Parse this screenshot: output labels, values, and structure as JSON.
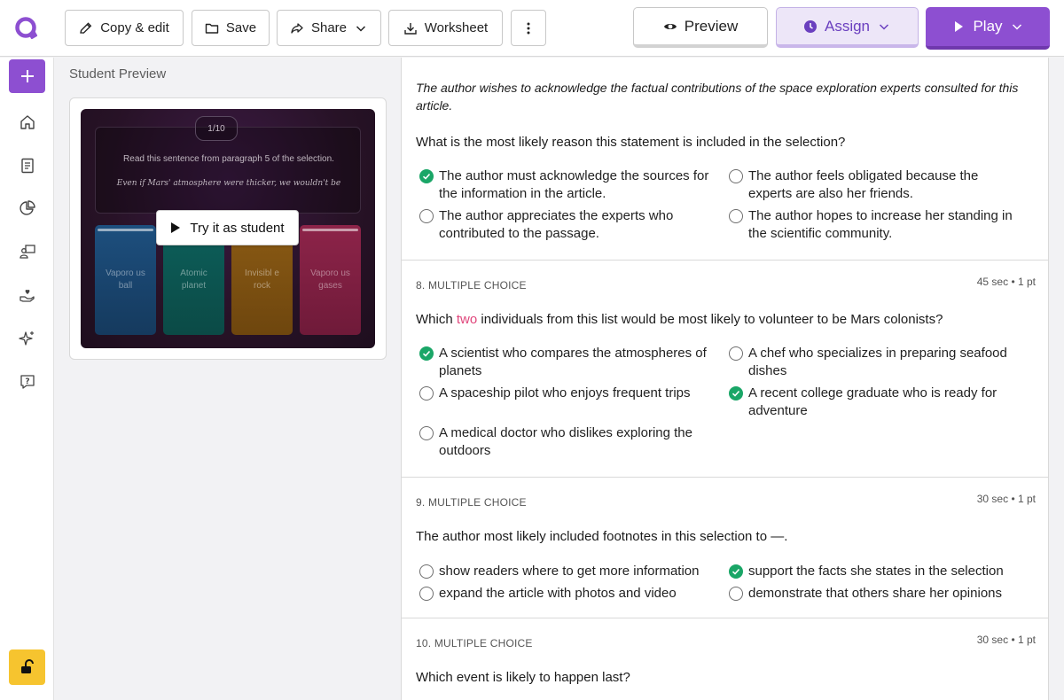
{
  "toolbar": {
    "copy_edit": "Copy & edit",
    "save": "Save",
    "share": "Share",
    "worksheet": "Worksheet",
    "preview": "Preview",
    "assign": "Assign",
    "play": "Play"
  },
  "colors": {
    "brand_purple": "#8d4fd1",
    "correct_green": "#1aa667",
    "highlight_pink": "#e0457b",
    "lock_yellow": "#f6c42f"
  },
  "sidebar": {
    "icons": [
      "add-icon",
      "home-icon",
      "library-icon",
      "reports-icon",
      "classes-icon",
      "accommodations-icon",
      "ai-sparkle-icon",
      "help-icon",
      "lock-icon"
    ]
  },
  "preview": {
    "title": "Student Preview",
    "counter": "1/10",
    "question_line1": "Read this sentence from paragraph 5 of the selection.",
    "question_line2": "Even if Mars' atmosphere were thicker, we wouldn't be",
    "options": [
      "Vaporo us ball",
      "Atomic planet",
      "Invisibl e rock",
      "Vaporo us gases"
    ],
    "try_button": "Try it as student"
  },
  "questions": {
    "q7": {
      "passage": "The author wishes to acknowledge the factual contributions of the space exploration experts consulted for this article.",
      "text": "What is the most likely reason this statement is included in the selection?",
      "options": [
        {
          "text": "The author must acknowledge the sources for the information in the article.",
          "correct": true
        },
        {
          "text": "The author feels obligated because the experts are also her friends.",
          "correct": false
        },
        {
          "text": "The author appreciates the experts who contributed to the passage.",
          "correct": false
        },
        {
          "text": "The author hopes to increase her standing in the scientific community.",
          "correct": false
        }
      ]
    },
    "q8": {
      "label": "8. MULTIPLE CHOICE",
      "meta": "45 sec • 1 pt",
      "text_before": "Which ",
      "text_highlight": "two",
      "text_after": " individuals from this list would be most likely to volunteer to be Mars colonists?",
      "options": [
        {
          "text": "A scientist who compares the atmospheres of planets",
          "correct": true
        },
        {
          "text": "A chef who specializes in preparing seafood dishes",
          "correct": false
        },
        {
          "text": "A spaceship pilot who enjoys frequent trips",
          "correct": false
        },
        {
          "text": "A recent college graduate who is ready for adventure",
          "correct": true
        },
        {
          "text": "A medical doctor who dislikes exploring the outdoors",
          "correct": false
        }
      ]
    },
    "q9": {
      "label": "9. MULTIPLE CHOICE",
      "meta": "30 sec • 1 pt",
      "text": "The author most likely included footnotes in this selection to —.",
      "options": [
        {
          "text": "show readers where to get more information",
          "correct": false
        },
        {
          "text": "support the facts she states in the selection",
          "correct": true
        },
        {
          "text": "expand the article with photos and video",
          "correct": false
        },
        {
          "text": "demonstrate that others share her opinions",
          "correct": false
        }
      ]
    },
    "q10": {
      "label": "10. MULTIPLE CHOICE",
      "meta": "30 sec • 1 pt",
      "text": "Which event is likely to happen last?"
    }
  }
}
